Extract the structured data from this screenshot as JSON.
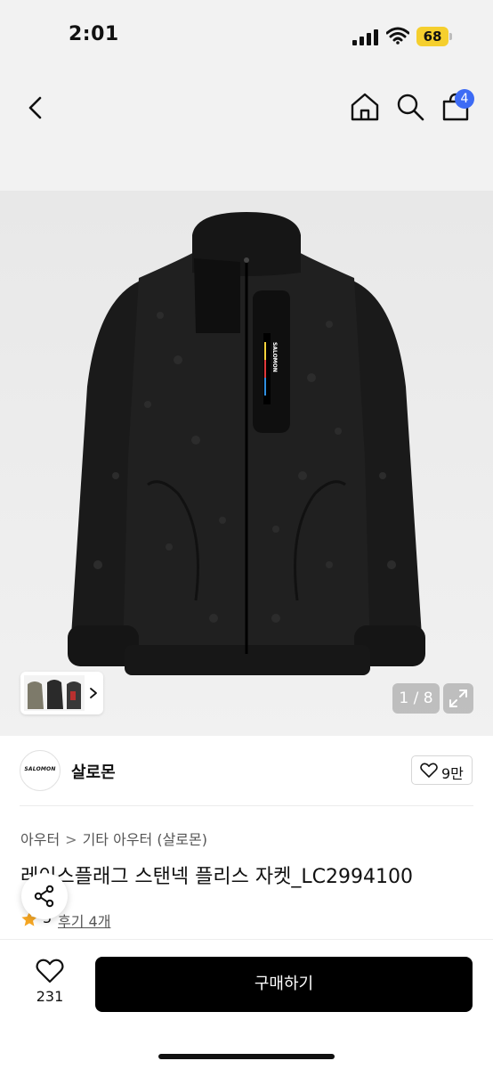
{
  "status_bar": {
    "time": "2:01",
    "battery": "68"
  },
  "nav": {
    "cart_count": "4"
  },
  "gallery": {
    "page_indicator": "1 / 8",
    "jacket_label": "SALOMON"
  },
  "brand": {
    "logo_text": "SALOMON",
    "name": "살로몬",
    "like_count": "9만"
  },
  "product": {
    "breadcrumb": [
      "아우터",
      "기타 아우터 (살로몬)"
    ],
    "title": "레이스플래그 스탠넥 플리스 자켓_LC2994100",
    "rating": "5",
    "review_link": "후기 4개"
  },
  "bottom_bar": {
    "wish_count": "231",
    "buy_label": "구매하기"
  },
  "colors": {
    "accent_badge": "#3d6bf5",
    "battery": "#f5cf2e",
    "star": "#f5a623",
    "buy_button": "#000000"
  },
  "icons": [
    "back-icon",
    "home-icon",
    "search-icon",
    "cart-icon",
    "chevron-right-icon",
    "expand-icon",
    "heart-icon",
    "star-icon",
    "share-icon"
  ]
}
